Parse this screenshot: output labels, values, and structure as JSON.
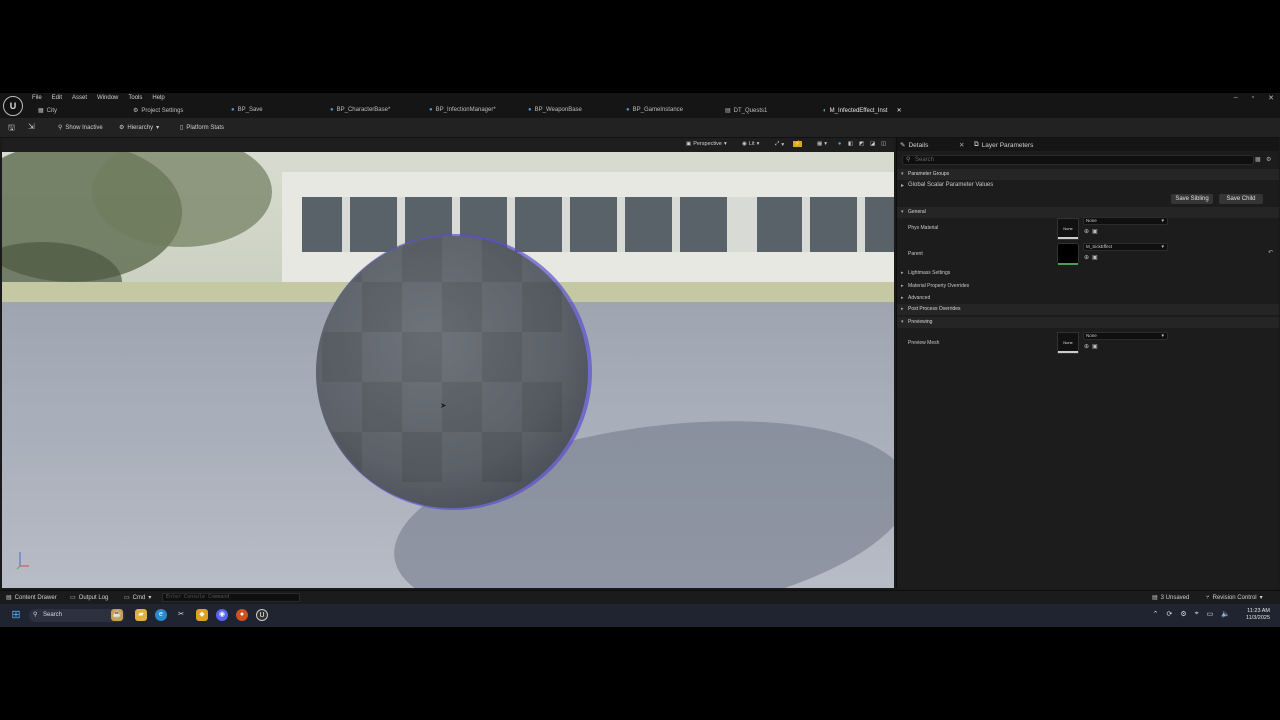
{
  "menu": {
    "items": [
      "File",
      "Edit",
      "Asset",
      "Window",
      "Tools",
      "Help"
    ]
  },
  "window_controls": {
    "minimize": "–",
    "maximize": "▫",
    "close": "✕"
  },
  "tabs": [
    {
      "label": "City",
      "icon": "level-icon"
    },
    {
      "label": "Project Settings",
      "icon": "gear-icon"
    },
    {
      "label": "BP_Save",
      "icon": "blueprint-icon"
    },
    {
      "label": "BP_CharacterBase*",
      "icon": "blueprint-icon"
    },
    {
      "label": "BP_InfectionManager*",
      "icon": "blueprint-icon"
    },
    {
      "label": "BP_WeaponBase",
      "icon": "blueprint-icon"
    },
    {
      "label": "BP_GameInstance",
      "icon": "blueprint-icon"
    },
    {
      "label": "DT_Quests1",
      "icon": "datatable-icon"
    },
    {
      "label": "M_InfectedEffect_Inst",
      "icon": "material-instance-icon"
    }
  ],
  "toolbar": {
    "show_inactive": "Show Inactive",
    "hierarchy": "Hierarchy",
    "platform_stats": "Platform Stats"
  },
  "viewport": {
    "perspective": "Perspective",
    "lit": "Lit"
  },
  "panel": {
    "tab_details": "Details",
    "tab_layer_params": "Layer Parameters",
    "search_placeholder": "Search",
    "parameter_groups": "Parameter Groups",
    "global_scalar": "Global Scalar Parameter Values",
    "save_sibling": "Save Sibling",
    "save_child": "Save Child",
    "general": "General",
    "phys_material_label": "Phys Material",
    "phys_material_thumb": "None",
    "phys_material_value": "None",
    "parent_label": "Parent",
    "parent_value": "M_SickEffect",
    "lightmass": "Lightmass Settings",
    "material_property_overrides": "Material Property Overrides",
    "advanced": "Advanced",
    "post_process": "Post Process Overrides",
    "previewing": "Previewing",
    "preview_mesh_label": "Preview Mesh",
    "preview_mesh_thumb": "None",
    "preview_mesh_value": "None"
  },
  "statusbar": {
    "content_drawer": "Content Drawer",
    "output_log": "Output Log",
    "cmd": "Cmd",
    "console_placeholder": "Enter Console Command",
    "unsaved": "3 Unsaved",
    "revision_control": "Revision Control"
  },
  "taskbar": {
    "search": "Search",
    "time": "11:23 AM",
    "date": "11/3/2025"
  }
}
